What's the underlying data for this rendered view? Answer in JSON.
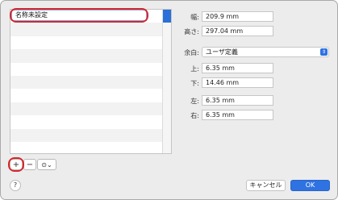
{
  "list": {
    "selected_name": "名称未設定",
    "row_count": 11
  },
  "paper": {
    "width_label": "幅:",
    "width_value": "209.9 mm",
    "height_label": "高さ:",
    "height_value": "297.04 mm"
  },
  "margins": {
    "label": "余白:",
    "preset": "ユーザ定義",
    "top_label": "上:",
    "top_value": "6.35 mm",
    "bottom_label": "下:",
    "bottom_value": "14.46 mm",
    "left_label": "左:",
    "left_value": "6.35 mm",
    "right_label": "右:",
    "right_value": "6.35 mm"
  },
  "toolbar": {
    "add_glyph": "+",
    "remove_glyph": "−",
    "action_glyph": "⊙⌄"
  },
  "buttons": {
    "help": "?",
    "cancel": "キャンセル",
    "ok": "OK"
  },
  "colors": {
    "accent": "#2f72e2",
    "highlight_ring": "#d5272d",
    "selection": "#2b6fd8"
  }
}
